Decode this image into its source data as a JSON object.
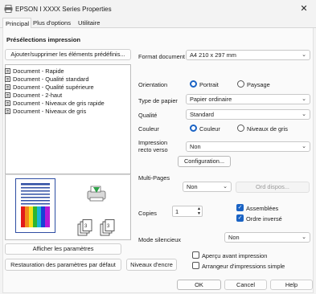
{
  "window": {
    "title": "EPSON I XXXX Series Properties",
    "close_glyph": "✕"
  },
  "tabs": [
    {
      "label": "Principal",
      "active": true
    },
    {
      "label": "Plus d'options",
      "active": false
    },
    {
      "label": "Utilitaire",
      "active": false
    }
  ],
  "presets": {
    "title": "Présélections impression",
    "add_remove_button": "Ajouter/supprimer les éléments prédéfinis...",
    "items": [
      "Document - Rapide",
      "Document - Qualité standard",
      "Document - Qualité supérieure",
      "Document - 2-haut",
      "Document - Niveaux de gris rapide",
      "Document - Niveaux de gris"
    ]
  },
  "bottom_left": {
    "show_settings_button": "Afficher les paramètres",
    "restore_defaults_button": "Restauration des paramètres par défaut",
    "ink_levels_button": "Niveaux d'encre"
  },
  "settings": {
    "format_label": "Format document",
    "format_value": "A4 210 x 297 mm",
    "orientation_label": "Orientation",
    "orientation_options": [
      "Portrait",
      "Paysage"
    ],
    "orientation_selected": "Portrait",
    "paper_type_label": "Type de papier",
    "paper_type_value": "Papier ordinaire",
    "quality_label": "Qualité",
    "quality_value": "Standard",
    "color_label": "Couleur",
    "color_options": [
      "Couleur",
      "Niveaux de gris"
    ],
    "color_selected": "Couleur",
    "duplex_label_line1": "Impression",
    "duplex_label_line2": "recto verso",
    "duplex_value": "Non",
    "configuration_button": "Configuration...",
    "multipages_label": "Multi-Pages",
    "multipages_value": "Non",
    "page_order_button": "Ord dispos...",
    "copies_label": "Copies",
    "copies_value": "1",
    "collate_label": "Assemblées",
    "collate_checked": true,
    "reverse_label": "Ordre inversé",
    "reverse_checked": true,
    "quiet_mode_label": "Mode silencieux",
    "quiet_mode_value": "Non",
    "preview_label": "Aperçu avant impression",
    "preview_checked": false,
    "arranger_label": "Arrangeur d'impressions simple",
    "arranger_checked": false
  },
  "footer": {
    "ok": "OK",
    "cancel": "Cancel",
    "help": "Help"
  },
  "colors": {
    "accent": "#1a63c4",
    "window_bg": "#f3f3f3",
    "panel_bg": "#fafafa"
  },
  "icons": [
    "printer-app-icon",
    "close-icon",
    "document-icon",
    "chevron-down-icon",
    "paper-preview-image",
    "printer-illustration",
    "copies-collate-icon"
  ]
}
